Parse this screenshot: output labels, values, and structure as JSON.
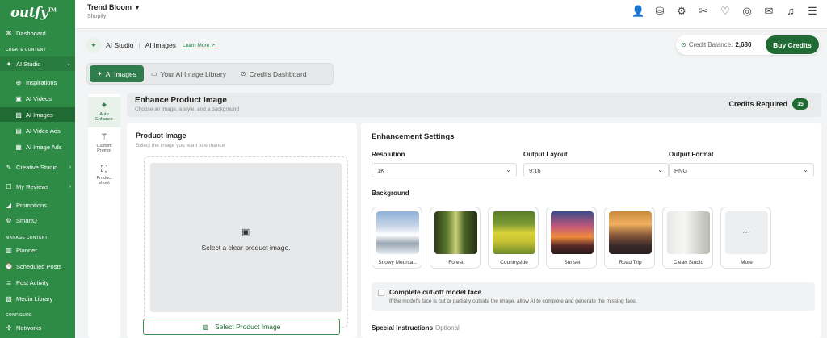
{
  "app": {
    "logo": "outfy",
    "logo_tm": "TM"
  },
  "sidebar": {
    "dashboard": "Dashboard",
    "section_create": "CREATE CONTENT",
    "ai_studio": "AI Studio",
    "inspirations": "Inspirations",
    "ai_videos": "AI Videos",
    "ai_images": "AI Images",
    "ai_video_ads": "AI Video Ads",
    "ai_image_ads": "AI Image Ads",
    "creative_studio": "Creative Studio",
    "my_reviews": "My Reviews",
    "promotions": "Promotions",
    "smartq": "SmartQ",
    "section_manage": "MANAGE CONTENT",
    "planner": "Planner",
    "scheduled_posts": "Scheduled Posts",
    "post_activity": "Post Activity",
    "media_library": "Media Library",
    "section_configure": "CONFIGURE",
    "networks": "Networks"
  },
  "topbar": {
    "store": "Trend Bloom",
    "platform": "Shopify"
  },
  "breadcrumb": {
    "studio": "AI Studio",
    "page": "AI Images",
    "learn_more": "Learn More"
  },
  "credits": {
    "label": "Credit Balance:",
    "value": "2,680",
    "buy": "Buy Credits"
  },
  "tabs": [
    "AI Images",
    "Your AI Image Library",
    "Credits Dashboard"
  ],
  "tools": {
    "auto_l1": "Auto",
    "auto_l2": "Enhance",
    "custom_l1": "Custom",
    "custom_l2": "Prompt",
    "shoot_l1": "Product",
    "shoot_l2": "shoot"
  },
  "enhance": {
    "title": "Enhance Product Image",
    "subtitle": "Choose an image, a style, and a background",
    "credits_label": "Credits Required",
    "credits_value": "15"
  },
  "product": {
    "title": "Product Image",
    "subtitle": "Select the image you want to enhance",
    "drop_msg": "Select a clear product image.",
    "select_btn": "Select Product Image"
  },
  "settings": {
    "title": "Enhancement Settings",
    "resolution_label": "Resolution",
    "resolution": "1K",
    "layout_label": "Output Layout",
    "layout": "9:16",
    "format_label": "Output Format",
    "format": "PNG",
    "background_label": "Background",
    "backgrounds": [
      "Snowy Mounta...",
      "Forest",
      "Countryside",
      "Sunset",
      "Road Trip",
      "Clean Studio",
      "More"
    ],
    "cut_title": "Complete cut-off model face",
    "cut_desc": "If the model's face is cut or partially outside the image, allow AI to complete and generate the missing face.",
    "special_label": "Special Instructions",
    "special_optional": "Optional"
  }
}
